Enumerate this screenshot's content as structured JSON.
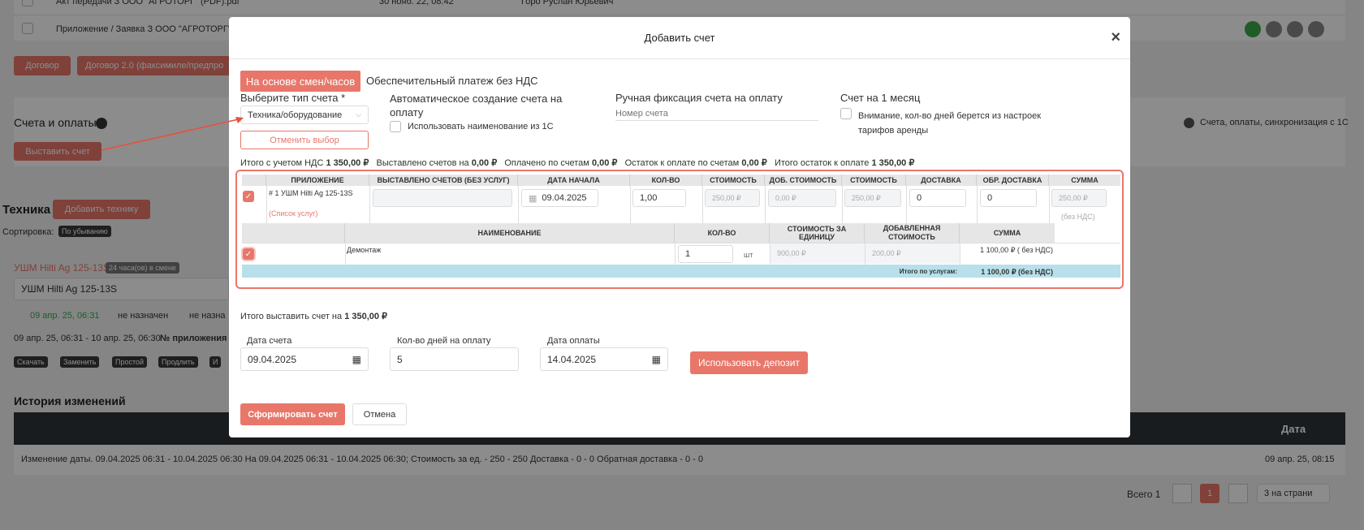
{
  "background": {
    "row1_text": "Акт передачи З ООО \"АГРОТОРГ\" (PDF).pdf",
    "row1_date": "30 нояб. 22, 08:42",
    "row1_user": "Горо Руслан Юрьевич",
    "row2_text": "Приложение / Заявка З ООО \"АГРОТОРГ\" (",
    "btn_contract": "Договор",
    "btn_contract2": "Договор 2.0 (факсимиле/предпро",
    "section_invoices": "Счета и оплаты",
    "btn_issue_invoice": "Выставить счет",
    "sync_info": "Счета, оплаты, синхронизация с 1С",
    "section_equipment": "Техника",
    "btn_add_equipment": "Добавить технику",
    "sort_label": "Сортировка:",
    "sort_value": "По убыванию",
    "equipment_name": "УШМ Hilti Ag 125-13S",
    "equipment_shift": "24 часа(ов) в смене",
    "equipment_input": "УШМ Hilti Ag 125-13S",
    "equipment_date": "09 апр. 25, 06:31",
    "not_assigned": "не назначен",
    "not_assigned2": "не назна",
    "period": "09 апр. 25, 06:31 - 10 апр. 25, 06:30",
    "annex_no": "№ приложения #",
    "actions": [
      "Скачать",
      "Заменить",
      "Простой",
      "Продлить",
      "И"
    ],
    "history_title": "История изменений",
    "history_col_date": "Дата",
    "history_row": "Изменение даты. 09.04.2025 06:31 - 10.04.2025 06:30 На 09.04.2025 06:31 - 10.04.2025 06:30; Стоимость за ед. - 250 - 250 Доставка - 0 - 0 Обратная доставка - 0 - 0",
    "history_row_date": "09 апр. 25, 08:15",
    "total_label": "Всего 1",
    "page_current": "1",
    "per_page": "3 на страни"
  },
  "modal": {
    "title": "Добавить счет",
    "tab_active": "На основе смен/часов",
    "tab_other": "Обеспечительный платеж без НДС",
    "type_label": "Выберите тип счета *",
    "type_value": "Техника/оборудование",
    "cancel_choice": "Отменить выбор",
    "auto_title": "Автоматическое создание счета на оплату",
    "use_1c_name": "Использовать наименование из 1С",
    "manual_title": "Ручная фиксация счета на оплату",
    "manual_placeholder": "Номер счета",
    "month_title": "Счет на 1 месяц",
    "month_note": "Внимание, кол-во дней берется из настроек тарифов аренды",
    "summary": {
      "total_vat_label": "Итого с учетом НДС",
      "total_vat": "1 350,00 ₽",
      "issued_label": "Выставлено счетов на",
      "issued": "0,00 ₽",
      "paid_label": "Оплачено по счетам",
      "paid": "0,00 ₽",
      "remaining_label": "Остаток к оплате по счетам",
      "remaining": "0,00 ₽",
      "total_remaining_label": "Итого остаток к оплате",
      "total_remaining": "1 350,00 ₽"
    },
    "table": {
      "headers": [
        "ПРИЛОЖЕНИЕ",
        "ВЫСТАВЛЕНО СЧЕТОВ (БЕЗ УСЛУГ)",
        "ДАТА НАЧАЛА",
        "КОЛ-ВО",
        "СТОИМОСТЬ",
        "ДОБ. СТОИМОСТЬ",
        "СТОИМОСТЬ",
        "ДОСТАВКА",
        "ОБР. ДОСТАВКА",
        "СУММА"
      ],
      "row": {
        "annex": "# 1 УШМ Hilti Ag 125-13S",
        "services_link": "(Список услуг)",
        "start_date": "09.04.2025",
        "qty": "1,00",
        "cost": "250,00 ₽",
        "add_cost": "0,00 ₽",
        "cost2": "250,00 ₽",
        "delivery": "0",
        "return_delivery": "0",
        "sum": "250,00 ₽",
        "sum_note": "(без НДС)"
      },
      "sub_headers": [
        "НАИМЕНОВАНИЕ",
        "КОЛ-ВО",
        "СТОИМОСТЬ ЗА ЕДИНИЦУ",
        "ДОБАВЛЕННАЯ СТОИМОСТЬ",
        "СУММА"
      ],
      "sub_row": {
        "name": "Демонтаж",
        "qty": "1",
        "unit": "шт",
        "unit_cost": "900,00 ₽",
        "add_cost": "200,00 ₽",
        "sum": "1 100,00 ₽ ( без НДС)"
      },
      "services_total_label": "Итого по услугам:",
      "services_total": "1 100,00 ₽ (без НДС)"
    },
    "invoice_total_label": "Итого выставить счет на",
    "invoice_total": "1 350,00 ₽",
    "date_label": "Дата счета",
    "date_value": "09.04.2025",
    "days_label": "Кол-во дней на оплату",
    "days_value": "5",
    "pay_date_label": "Дата оплаты",
    "pay_date_value": "14.04.2025",
    "deposit_btn": "Использовать депозит",
    "submit_btn": "Сформировать счет",
    "cancel_btn": "Отмена"
  },
  "colors": {
    "accent": "#e8776a",
    "header_dark": "#2f333a",
    "total_row": "#b7e0ea"
  }
}
